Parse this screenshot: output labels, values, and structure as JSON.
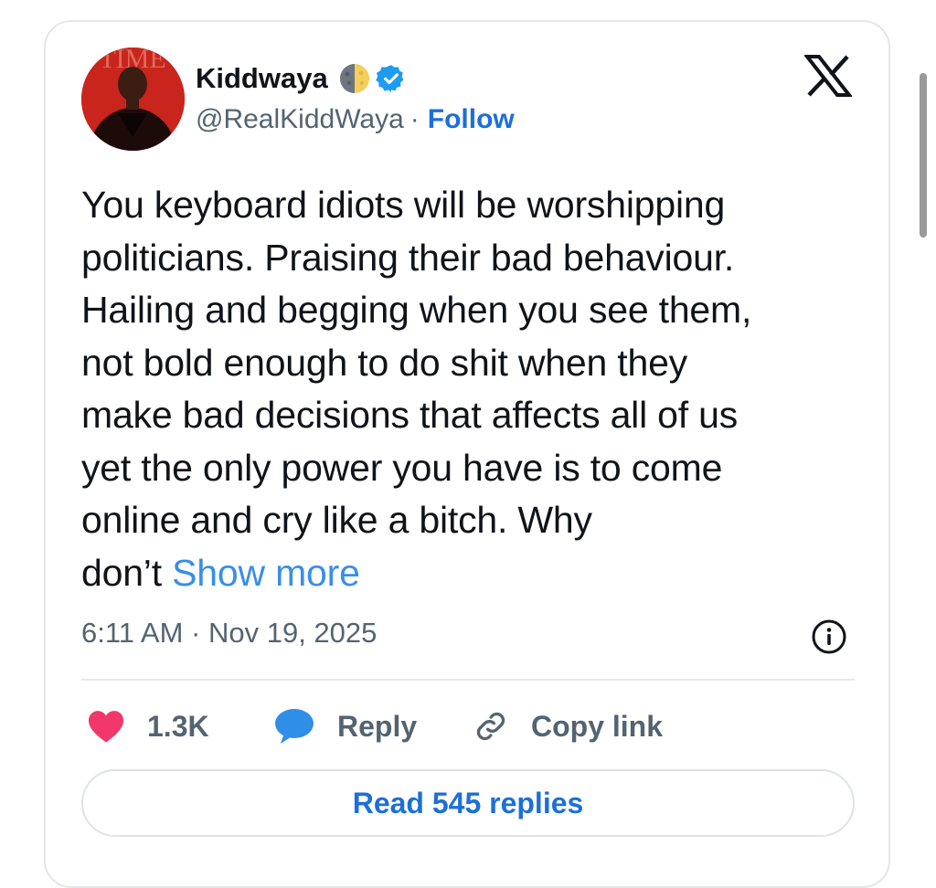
{
  "author": {
    "display_name": "Kiddwaya",
    "handle": "@RealKiddWaya",
    "separator": "·",
    "follow_label": "Follow",
    "avatar_text": "TIME"
  },
  "tweet": {
    "lines": [
      "You keyboard idiots will be worshipping",
      "politicians. Praising their bad behaviour.",
      "Hailing and begging when you see them,",
      "not bold enough to do shit when they",
      "make bad decisions that affects all of us",
      "yet the only power you have is to come",
      "online and cry like a bitch. Why",
      "don’t"
    ],
    "show_more_label": "Show more",
    "timestamp": "6:11 AM · Nov 19, 2025"
  },
  "actions": {
    "like_count": "1.3K",
    "reply_label": "Reply",
    "copy_label": "Copy link"
  },
  "read_replies_label": "Read 545 replies",
  "icons": {
    "moon": "moon-icon",
    "verified": "verified-badge-icon",
    "logo": "x-logo-icon",
    "info": "info-icon",
    "heart": "heart-icon",
    "reply": "reply-bubble-icon",
    "link": "link-icon"
  },
  "colors": {
    "accent": "#1d6fd8",
    "show_more": "#3a8ee6",
    "heart": "#f2386a",
    "reply_bubble": "#2f8ee8",
    "verified": "#1d9bf0",
    "avatar_bg": "#c9251c"
  }
}
